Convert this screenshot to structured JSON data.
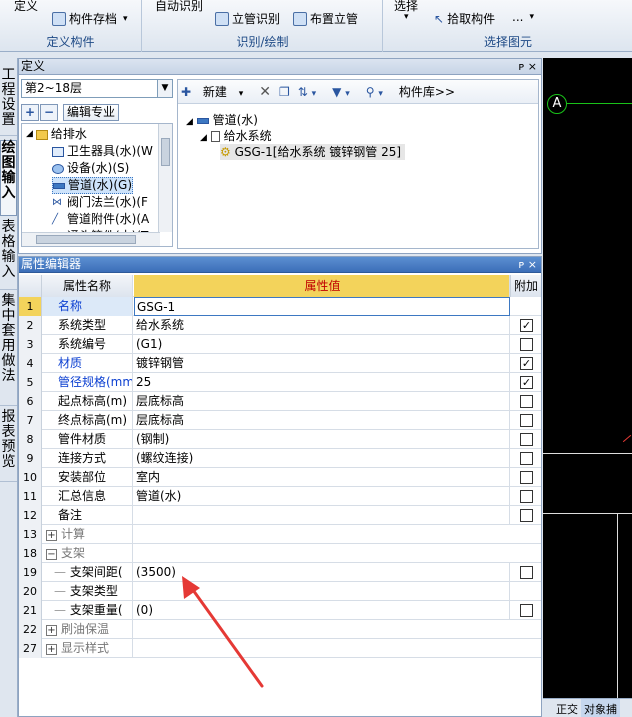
{
  "ribbon": {
    "groups": [
      {
        "title": "定义构件",
        "buttons": [
          "定义",
          "构件存档"
        ]
      },
      {
        "title": "识别/绘制",
        "buttons": [
          "自动识别",
          "立管识别",
          "布置立管"
        ]
      },
      {
        "title": "选择图元",
        "buttons": [
          "选择",
          "拾取构件",
          "..."
        ]
      }
    ]
  },
  "vtabs": [
    "工程设置",
    "绘图输入",
    "表格输入",
    "集中套用做法",
    "报表预览"
  ],
  "define_panel": {
    "title": "定义",
    "pin": "ᴘ",
    "close": "×",
    "floor": "第2~18层",
    "edit_major": "编辑专业",
    "tree": [
      {
        "label": "给排水",
        "level": 0
      },
      {
        "label": "卫生器具(水)(W",
        "level": 1
      },
      {
        "label": "设备(水)(S)",
        "level": 1
      },
      {
        "label": "管道(水)(G)",
        "level": 1
      },
      {
        "label": "阀门法兰(水)(F",
        "level": 1
      },
      {
        "label": "管道附件(水)(A",
        "level": 1
      },
      {
        "label": "通头管件(水)(T",
        "level": 1
      }
    ],
    "toolbar": {
      "new": "新建",
      "lib": "构件库>>"
    },
    "rtree": [
      {
        "label": "管道(水)"
      },
      {
        "label": "给水系统"
      },
      {
        "label": "GSG-1[给水系统 镀锌钢管 25]"
      }
    ]
  },
  "prop_panel": {
    "title": "属性编辑器",
    "headers": {
      "name": "属性名称",
      "value": "属性值",
      "add": "附加"
    },
    "rows": [
      {
        "num": "1",
        "name": "名称",
        "value": "GSG-1",
        "check": null
      },
      {
        "num": "2",
        "name": "系统类型",
        "value": "给水系统",
        "check": true
      },
      {
        "num": "3",
        "name": "系统编号",
        "value": "(G1)",
        "check": false
      },
      {
        "num": "4",
        "name": "材质",
        "value": "镀锌钢管",
        "check": true
      },
      {
        "num": "5",
        "name": "管径规格(mm",
        "value": "25",
        "check": true
      },
      {
        "num": "6",
        "name": "起点标高(m)",
        "value": "层底标高",
        "check": false
      },
      {
        "num": "7",
        "name": "终点标高(m)",
        "value": "层底标高",
        "check": false
      },
      {
        "num": "8",
        "name": "管件材质",
        "value": "(钢制)",
        "check": false
      },
      {
        "num": "9",
        "name": "连接方式",
        "value": "(螺纹连接)",
        "check": false
      },
      {
        "num": "10",
        "name": "安装部位",
        "value": "室内",
        "check": false
      },
      {
        "num": "11",
        "name": "汇总信息",
        "value": "管道(水)",
        "check": false
      },
      {
        "num": "12",
        "name": "备注",
        "value": "",
        "check": false
      },
      {
        "num": "13",
        "name": "计算",
        "value": "",
        "check": null
      },
      {
        "num": "18",
        "name": "支架",
        "value": "",
        "check": null
      },
      {
        "num": "19",
        "name": "支架间距(",
        "value": "(3500)",
        "check": false
      },
      {
        "num": "20",
        "name": "支架类型",
        "value": "",
        "check": null
      },
      {
        "num": "21",
        "name": "支架重量(",
        "value": "(0)",
        "check": false
      },
      {
        "num": "22",
        "name": "刷油保温",
        "value": "",
        "check": null
      },
      {
        "num": "27",
        "name": "显示样式",
        "value": "",
        "check": null
      }
    ]
  },
  "cad": {
    "axis_label": "A",
    "bottom_tabs": [
      "正交",
      "对象捕"
    ]
  },
  "colors": {
    "accent": "#3c6eb8",
    "value_header": "#f3d35b",
    "arrow": "#e53935"
  }
}
